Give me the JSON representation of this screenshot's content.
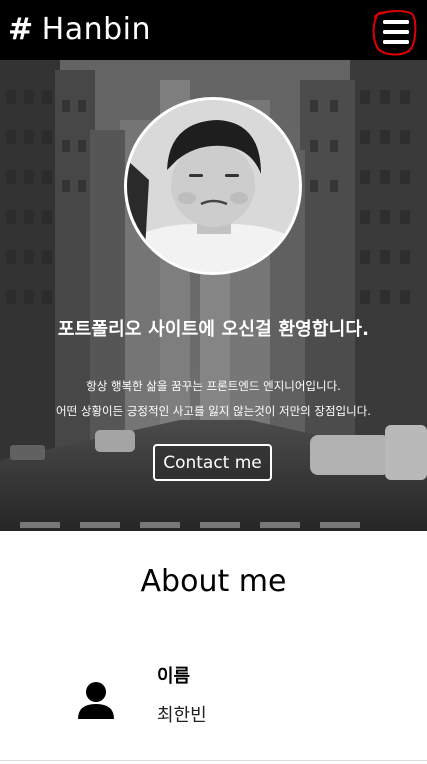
{
  "navbar": {
    "brand_hash": "#",
    "brand_name": "Hanbin",
    "menu_icon": "hamburger-menu-icon"
  },
  "hero": {
    "title": "포트폴리오 사이트에 오신걸 환영합니다.",
    "line1": "항상 행복한 삶을 꿈꾸는 프론트엔드 엔지니어입니다.",
    "line2": "어떤 상황이든 긍정적인 사고를 잃지 않는것이 저만의 장점입니다.",
    "contact_label": "Contact me"
  },
  "about": {
    "title": "About me",
    "items": [
      {
        "icon": "person-icon",
        "label": "이름",
        "value": "최한빈"
      }
    ]
  },
  "colors": {
    "navbar_bg": "#000000",
    "menu_annotation": "#e00000",
    "text_light": "#ffffff"
  }
}
